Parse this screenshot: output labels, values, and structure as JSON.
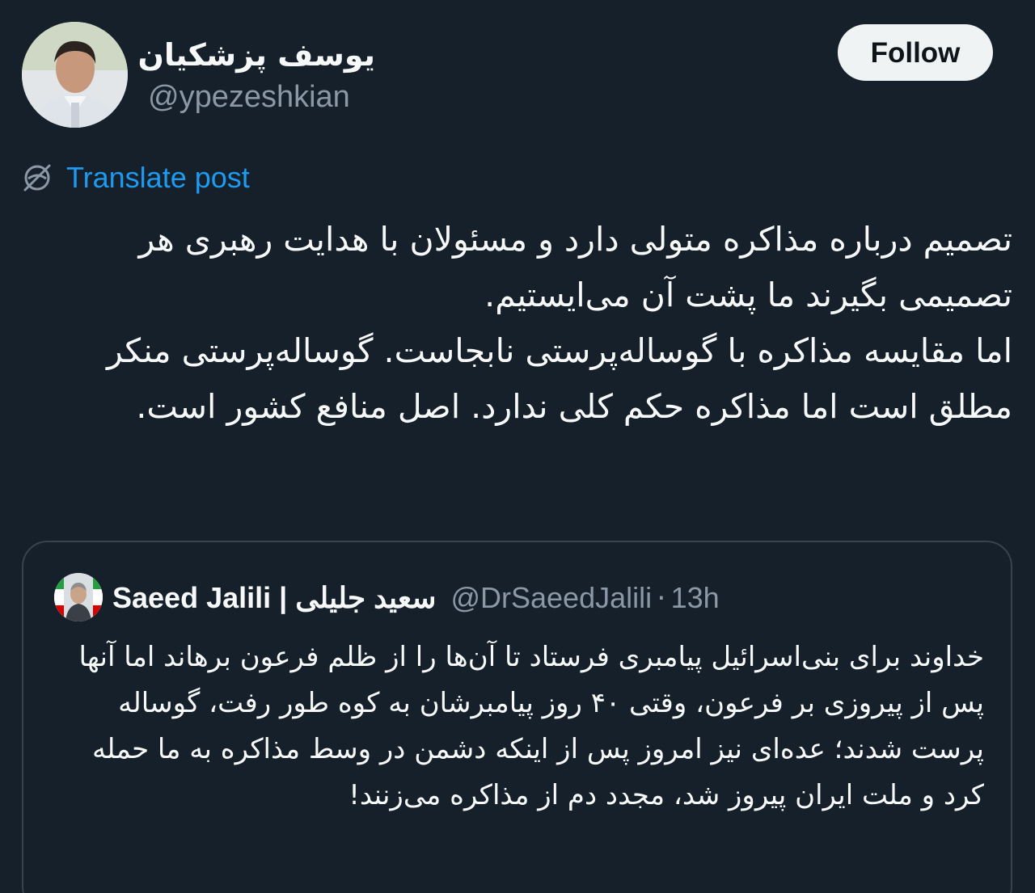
{
  "author": {
    "display_name": "یوسف پزشکیان",
    "handle": "@ypezeshkian",
    "avatar_icon": "profile-photo"
  },
  "follow_label": "Follow",
  "translate_label": "Translate post",
  "post_paragraphs": [
    "تصمیم درباره مذاکره متولی دارد و مسئولان با هدایت رهبری هر تصمیمی بگیرند ما پشت آن می‌ایستیم.",
    "اما مقایسه مذاکره با گوساله‌پرستی نابجاست. گوساله‌پرستی منکر مطلق است اما مذاکره حکم کلی ندارد. اصل منافع کشور است."
  ],
  "quote": {
    "display_name": "Saeed Jalili | سعید جلیلی",
    "handle": "@DrSaeedJalili",
    "separator": "·",
    "time": "13h",
    "text": "خداوند برای بنی‌اسرائیل پیامبری فرستاد تا آن‌ها را از ظلم فرعون برهاند اما آنها پس از پیروزی بر فرعون، وقتی ۴۰ روز پیامبرشان به کوه طور رفت، گوساله پرست شدند؛ عده‌ای نیز امروز پس از اینکه دشمن در وسط مذاکره به ما حمله کرد و ملت ایران پیروز شد، مجدد دم از مذاکره می‌زنند!"
  },
  "colors": {
    "background": "#15202b",
    "link": "#1d9bf0",
    "secondary_text": "#8b98a5",
    "border": "#38444d",
    "follow_bg": "#eff3f4"
  }
}
